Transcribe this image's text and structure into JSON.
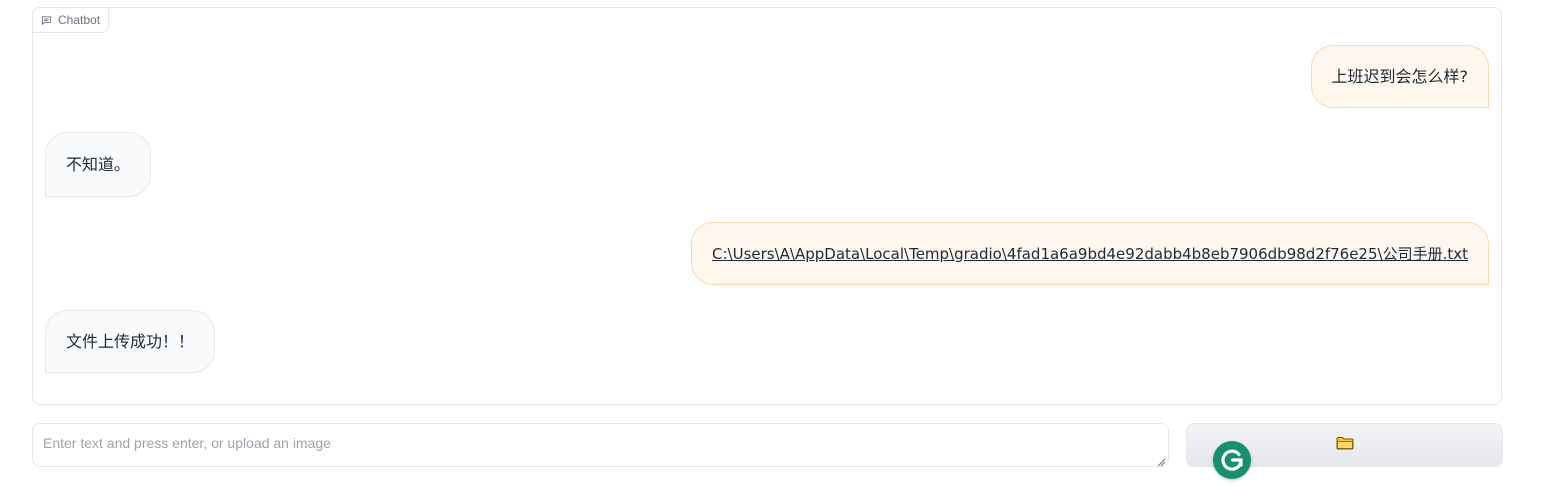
{
  "chatbot": {
    "label": "Chatbot",
    "messages": [
      {
        "role": "user",
        "text": "上班迟到会怎么样?"
      },
      {
        "role": "bot",
        "text": "不知道。"
      },
      {
        "role": "user",
        "text": "C:\\Users\\A\\AppData\\Local\\Temp\\gradio\\4fad1a6a9bd4e92dabb4b8eb7906db98d2f76e25\\公司手册.txt",
        "is_link": true
      },
      {
        "role": "bot",
        "text": "文件上传成功！！"
      }
    ]
  },
  "input": {
    "placeholder": "Enter text and press enter, or upload an image",
    "value": ""
  },
  "upload": {
    "icon": "folder-icon"
  },
  "grammarly": {
    "icon": "grammarly-icon",
    "letter": "G"
  },
  "colors": {
    "user_bubble_bg": "#fff7ed",
    "user_bubble_border": "#fed7aa",
    "bot_bubble_bg": "#f9fafb",
    "grammarly": "#15906e"
  }
}
